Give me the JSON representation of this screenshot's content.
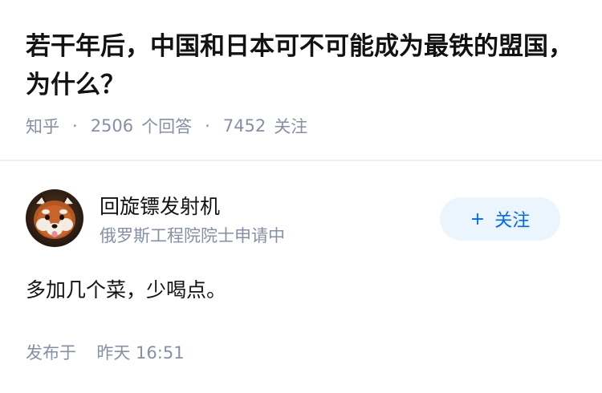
{
  "question": {
    "title": "若干年后，中国和日本可不可能成为最铁的盟国，为什么？",
    "source": "知乎",
    "answer_count": "2506",
    "answer_label": "个回答",
    "follow_count": "7452",
    "follow_label": "关注"
  },
  "author": {
    "name": "回旋镖发射机",
    "badge": "俄罗斯工程院院士申请中",
    "avatar_icon": "red-panda-avatar",
    "follow_button": {
      "plus": "+",
      "label": "关注"
    }
  },
  "answer": {
    "content": "多加几个菜，少喝点。",
    "published_label": "发布于",
    "published_time": "昨天 16:51"
  },
  "colors": {
    "primary": "#0066ff",
    "follow_bg": "#ebf5fd",
    "muted": "#8590a6",
    "text": "#121212"
  }
}
